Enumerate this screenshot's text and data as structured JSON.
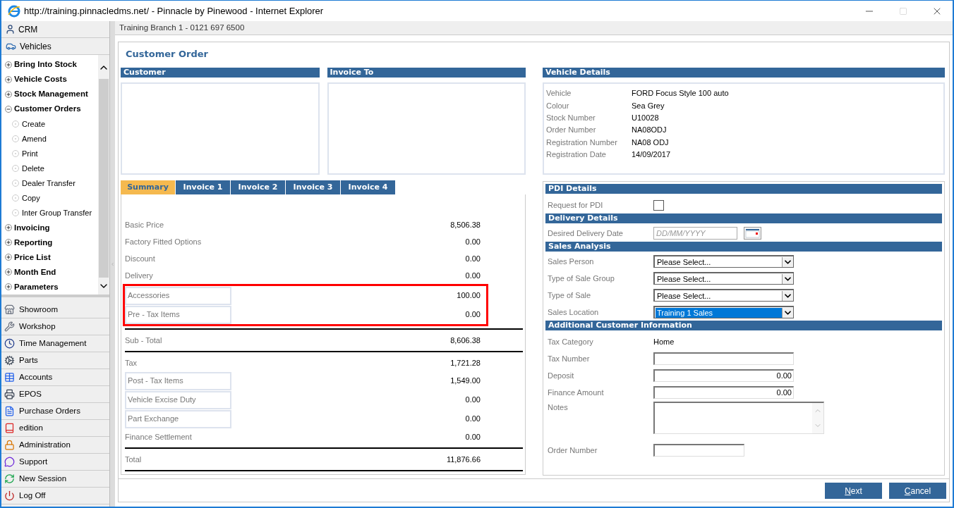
{
  "window": {
    "title": "http://training.pinnacledms.net/ - Pinnacle by Pinewood - Internet Explorer"
  },
  "sidebar": {
    "top_items": [
      {
        "label": "CRM"
      },
      {
        "label": "Vehicles"
      }
    ],
    "tree": [
      {
        "label": "Bring Into Stock",
        "expanded": false
      },
      {
        "label": "Vehicle Costs",
        "expanded": false
      },
      {
        "label": "Stock Management",
        "expanded": false
      },
      {
        "label": "Customer Orders",
        "expanded": true,
        "children": [
          {
            "label": "Create"
          },
          {
            "label": "Amend"
          },
          {
            "label": "Print"
          },
          {
            "label": "Delete"
          },
          {
            "label": "Dealer Transfer"
          },
          {
            "label": "Copy"
          },
          {
            "label": "Inter Group Transfer"
          }
        ]
      },
      {
        "label": "Invoicing",
        "expanded": false
      },
      {
        "label": "Reporting",
        "expanded": false
      },
      {
        "label": "Price List",
        "expanded": false
      },
      {
        "label": "Month End",
        "expanded": false
      },
      {
        "label": "Parameters",
        "expanded": false
      }
    ],
    "modules": [
      {
        "label": "Showroom"
      },
      {
        "label": "Workshop"
      },
      {
        "label": "Time Management"
      },
      {
        "label": "Parts"
      },
      {
        "label": "Accounts"
      },
      {
        "label": "EPOS"
      },
      {
        "label": "Purchase Orders"
      },
      {
        "label": "edition"
      },
      {
        "label": "Administration"
      },
      {
        "label": "Support"
      },
      {
        "label": "New Session"
      },
      {
        "label": "Log Off"
      }
    ]
  },
  "branch_bar": "Training Branch 1 - 0121 697 6500",
  "page": {
    "title": "Customer Order",
    "customer": {
      "heading": "Customer"
    },
    "invoice_to": {
      "heading": "Invoice To"
    },
    "tabs": [
      {
        "label": "Summary",
        "selected": true
      },
      {
        "label": "Invoice 1",
        "selected": false
      },
      {
        "label": "Invoice 2",
        "selected": false
      },
      {
        "label": "Invoice 3",
        "selected": false
      },
      {
        "label": "Invoice 4",
        "selected": false
      }
    ],
    "summary_rows": [
      {
        "label": "Basic Price",
        "value": "8,506.38",
        "kind": "plain",
        "highlighted": false,
        "rule_below": false
      },
      {
        "label": "Factory Fitted Options",
        "value": "0.00",
        "kind": "plain",
        "highlighted": false,
        "rule_below": false
      },
      {
        "label": "Discount",
        "value": "0.00",
        "kind": "plain",
        "highlighted": false,
        "rule_below": false
      },
      {
        "label": "Delivery",
        "value": "0.00",
        "kind": "plain",
        "highlighted": false,
        "rule_below": false
      },
      {
        "label": "Accessories",
        "value": "100.00",
        "kind": "boxed",
        "highlighted": true,
        "rule_below": false
      },
      {
        "label": "Pre - Tax Items",
        "value": "0.00",
        "kind": "boxed",
        "highlighted": true,
        "rule_below": true
      },
      {
        "label": "Sub - Total",
        "value": "8,606.38",
        "kind": "plain",
        "highlighted": false,
        "rule_below": true
      },
      {
        "label": "Tax",
        "value": "1,721.28",
        "kind": "plain",
        "highlighted": false,
        "rule_below": false
      },
      {
        "label": "Post - Tax Items",
        "value": "1,549.00",
        "kind": "boxed",
        "highlighted": false,
        "rule_below": false
      },
      {
        "label": "Vehicle Excise Duty",
        "value": "0.00",
        "kind": "boxed",
        "highlighted": false,
        "rule_below": false
      },
      {
        "label": "Part Exchange",
        "value": "0.00",
        "kind": "boxed",
        "highlighted": false,
        "rule_below": false
      },
      {
        "label": "Finance Settlement",
        "value": "0.00",
        "kind": "plain",
        "highlighted": false,
        "rule_below": true
      },
      {
        "label": "Total",
        "value": "11,876.66",
        "kind": "plain",
        "highlighted": false,
        "rule_below": true
      }
    ],
    "vehicle_details": {
      "heading": "Vehicle Details",
      "rows": [
        {
          "label": "Vehicle",
          "value": "FORD Focus Style 100 auto"
        },
        {
          "label": "Colour",
          "value": "Sea Grey"
        },
        {
          "label": "Stock Number",
          "value": "U10028"
        },
        {
          "label": "Order Number",
          "value": "NA08ODJ"
        },
        {
          "label": "Registration Number",
          "value": "NA08 ODJ"
        },
        {
          "label": "Registration Date",
          "value": "14/09/2017"
        }
      ]
    },
    "sections": [
      {
        "heading": "PDI Details",
        "fields": [
          {
            "label": "Request for PDI",
            "kind": "checkbox",
            "checked": false
          }
        ]
      },
      {
        "heading": "Delivery Details",
        "fields": [
          {
            "label": "Desired Delivery Date",
            "kind": "date",
            "placeholder": "DD/MM/YYYY"
          }
        ]
      },
      {
        "heading": "Sales Analysis",
        "fields": [
          {
            "label": "Sales Person",
            "kind": "select",
            "value": "Please Select...",
            "highlighted": false
          },
          {
            "label": "Type of Sale Group",
            "kind": "select",
            "value": "Please Select...",
            "highlighted": false
          },
          {
            "label": "Type of Sale",
            "kind": "select",
            "value": "Please Select...",
            "highlighted": false
          },
          {
            "label": "Sales Location",
            "kind": "select",
            "value": "Training 1 Sales",
            "highlighted": true
          }
        ]
      },
      {
        "heading": "Additional Customer Information",
        "fields": [
          {
            "label": "Tax Category",
            "kind": "text",
            "value": "Home"
          },
          {
            "label": "Tax Number",
            "kind": "input"
          },
          {
            "label": "Deposit",
            "kind": "input",
            "value": "0.00"
          },
          {
            "label": "Finance Amount",
            "kind": "input",
            "value": "0.00"
          },
          {
            "label": "Notes",
            "kind": "textarea"
          },
          {
            "label": "Order Number",
            "kind": "short_input"
          }
        ]
      }
    ]
  },
  "buttons": [
    {
      "label": "Next"
    },
    {
      "label": "Cancel"
    }
  ]
}
